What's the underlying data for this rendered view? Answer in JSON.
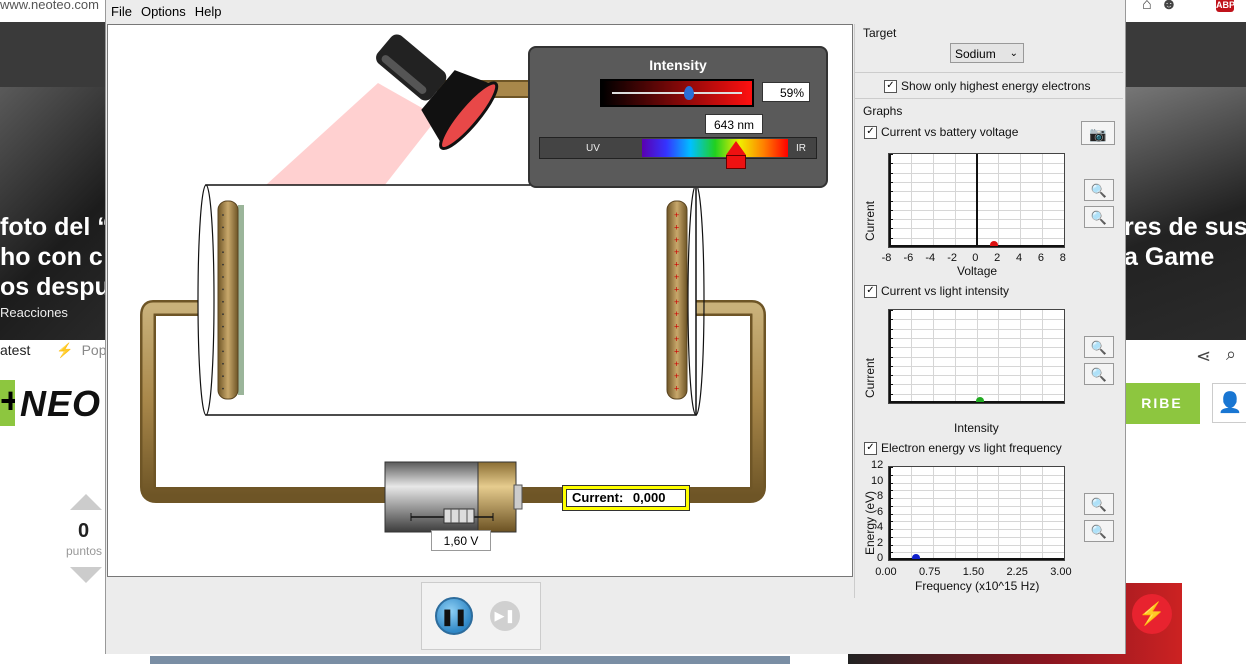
{
  "background_site": {
    "url": "www.neoteo.com",
    "headline_left": [
      "foto del “",
      "ho con c",
      "os despu"
    ],
    "headline_right": [
      "res de sus",
      "a Game"
    ],
    "reactions": "Reacciones",
    "tab_latest": "atest",
    "tab_popular": "Popu",
    "logo": "NEO",
    "subscribe": "RIBE",
    "votes": "0",
    "votes_label": "puntos"
  },
  "menu": {
    "file": "File",
    "options": "Options",
    "help": "Help"
  },
  "intensity_panel": {
    "title": "Intensity",
    "intensity_value": "59%",
    "intensity_level": 0.59,
    "wavelength_value": "643 nm",
    "uv_label": "UV",
    "ir_label": "IR"
  },
  "circuit": {
    "current_label": "Current:",
    "current_value": "0,000",
    "battery_voltage": "1,60 V"
  },
  "sidebar": {
    "target_label": "Target",
    "target_value": "Sodium",
    "show_highest_label": "Show only highest energy electrons",
    "graphs_label": "Graphs",
    "graph1_label": "Current vs battery voltage",
    "graph2_label": "Current vs light intensity",
    "graph3_label": "Electron energy vs light frequency"
  },
  "chart_data": [
    {
      "type": "scatter",
      "title": "Current vs battery voltage",
      "xlabel": "Voltage",
      "ylabel": "Current",
      "x_ticks": [
        "-8",
        "-6",
        "-4",
        "-2",
        "0",
        "2",
        "4",
        "6",
        "8"
      ],
      "xlim": [
        -8,
        8
      ],
      "points": [
        {
          "x": 1.6,
          "y": 0
        }
      ],
      "point_color": "#dd1111"
    },
    {
      "type": "scatter",
      "title": "Current vs light intensity",
      "xlabel": "Intensity",
      "ylabel": "Current",
      "points": [
        {
          "x": 0.59,
          "y": 0
        }
      ],
      "point_color": "#22aa22"
    },
    {
      "type": "line",
      "title": "Electron energy vs light frequency",
      "xlabel": "Frequency (x10^15 Hz)",
      "ylabel": "Energy (eV)",
      "x_ticks": [
        "0.00",
        "0.75",
        "1.50",
        "2.25",
        "3.00"
      ],
      "y_ticks": [
        "0",
        "2",
        "4",
        "6",
        "8",
        "10",
        "12"
      ],
      "xlim": [
        0,
        3.0
      ],
      "ylim": [
        0,
        12
      ],
      "points": [
        {
          "x": 0.47,
          "y": 0
        }
      ],
      "point_color": "#1122cc"
    }
  ],
  "controls": {
    "pause_symbol": "❚❚",
    "step_symbol": "▶❚"
  }
}
